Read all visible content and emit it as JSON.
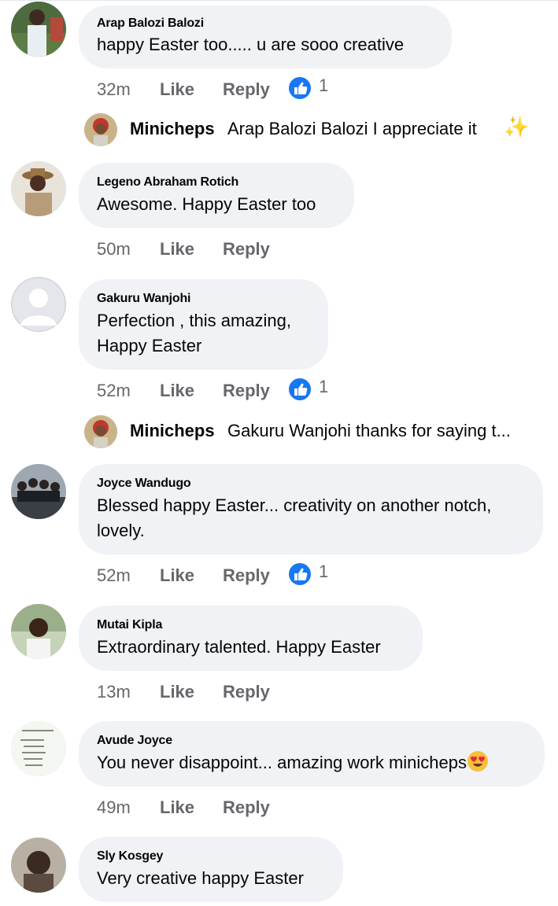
{
  "comments": [
    {
      "author": "Arap Balozi Balozi",
      "text": "happy Easter too..... u are  sooo creative",
      "time": "32m",
      "like": "Like",
      "reply": "Reply",
      "reaction_count": "1",
      "reply_item": {
        "author": "Minicheps",
        "text": "Arap Balozi Balozi I appreciate it",
        "trailing_icon": "sparkles-emoji"
      }
    },
    {
      "author": "Legeno Abraham Rotich",
      "text": "Awesome. Happy Easter too",
      "time": "50m",
      "like": "Like",
      "reply": "Reply"
    },
    {
      "author": "Gakuru Wanjohi",
      "text_lines": [
        "Perfection , this amazing,",
        "Happy Easter"
      ],
      "time": "52m",
      "like": "Like",
      "reply": "Reply",
      "reaction_count": "1",
      "reply_item": {
        "author": "Minicheps",
        "text": "Gakuru Wanjohi thanks for saying t..."
      }
    },
    {
      "author": "Joyce Wandugo",
      "text_lines": [
        "Blessed happy Easter... creativity on another notch,",
        "lovely."
      ],
      "time": "52m",
      "like": "Like",
      "reply": "Reply",
      "reaction_count": "1"
    },
    {
      "author": "Mutai Kipla",
      "text": "Extraordinary talented. Happy Easter",
      "time": "13m",
      "like": "Like",
      "reply": "Reply"
    },
    {
      "author": "Avude Joyce",
      "text": "You never disappoint... amazing work minicheps",
      "trailing_icon": "heart-eyes-emoji",
      "time": "49m",
      "like": "Like",
      "reply": "Reply"
    },
    {
      "author": "Sly Kosgey",
      "text": "Very creative happy Easter"
    }
  ],
  "colors": {
    "bubble": "#f0f2f5",
    "meta_text": "#65676b",
    "like_reaction": "#1877f2",
    "name_text": "#050505"
  }
}
